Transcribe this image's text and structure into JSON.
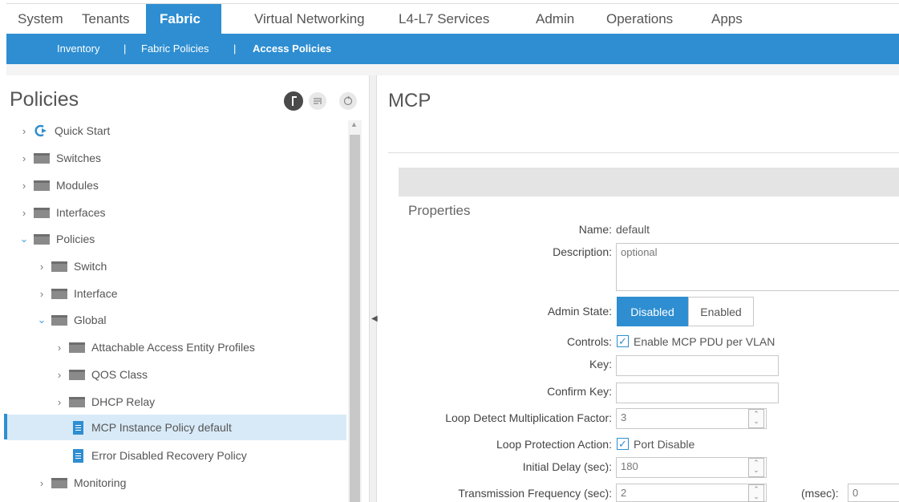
{
  "topnav": {
    "tabs": [
      "System",
      "Tenants",
      "Fabric",
      "Virtual Networking",
      "L4-L7 Services",
      "Admin",
      "Operations",
      "Apps"
    ]
  },
  "subnav": {
    "items": [
      "Inventory",
      "|",
      "Fabric Policies",
      "|",
      "Access Policies"
    ]
  },
  "left": {
    "title": "Policies",
    "tree": [
      "Quick Start",
      "Switches",
      "Modules",
      "Interfaces",
      "Policies",
      "Switch",
      "Interface",
      "Global",
      "Attachable Access Entity Profiles",
      "QOS Class",
      "DHCP Relay",
      "MCP Instance Policy default",
      "Error Disabled Recovery Policy",
      "Monitoring"
    ]
  },
  "main": {
    "title": "MCP",
    "properties_title": "Properties",
    "name_label": "Name:",
    "name_value": "default",
    "description_label": "Description:",
    "description_placeholder": "optional",
    "admin_state_label": "Admin State:",
    "admin_state_disabled": "Disabled",
    "admin_state_enabled": "Enabled",
    "controls_label": "Controls:",
    "controls_checkbox": "Enable MCP PDU per VLAN",
    "key_label": "Key:",
    "confirm_key_label": "Confirm Key:",
    "loop_factor_label": "Loop Detect Multiplication Factor:",
    "loop_factor_value": "3",
    "loop_action_label": "Loop Protection Action:",
    "loop_action_checkbox": "Port Disable",
    "initial_delay_label": "Initial Delay (sec):",
    "initial_delay_value": "180",
    "tx_freq_label": "Transmission Frequency (sec):",
    "tx_freq_value": "2",
    "msec_label": "(msec):",
    "msec_value": "0"
  },
  "colors": {
    "accent": "#2e8ed1"
  },
  "icons": {
    "header": [
      "circle-info-icon",
      "filter-icon",
      "refresh-icon"
    ],
    "quick_start": "quick-start-icon",
    "folder": "folder-icon",
    "policy": "document-icon"
  }
}
